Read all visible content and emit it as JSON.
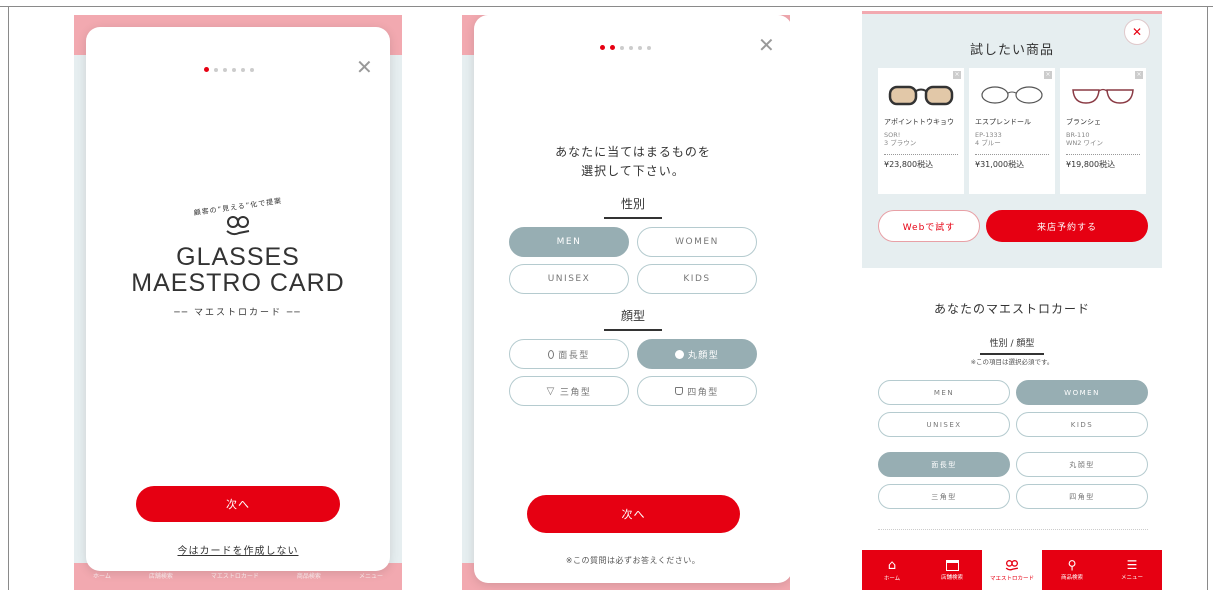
{
  "colors": {
    "accent": "#e60012",
    "selected": "#97aeb3",
    "pink": "#f2a9b0"
  },
  "panel1": {
    "logo_arc_text": "顧客の”見える”化で提案",
    "logo_icon": "glasses-hand-icon",
    "logo_line1": "GLASSES",
    "logo_line2": "MAESTRO CARD",
    "logo_sub": "── マエストロカード ──",
    "next_label": "次へ",
    "skip_label": "今はカードを作成しない",
    "bg_nav": [
      "ホーム",
      "店舗検索",
      "マエストロカード",
      "商品検索",
      "メニュー"
    ]
  },
  "panel2": {
    "question_line1": "あなたに当てはまるものを",
    "question_line2": "選択して下さい。",
    "gender_heading": "性別",
    "genders": [
      "MEN",
      "WOMEN",
      "UNISEX",
      "KIDS"
    ],
    "face_heading": "顔型",
    "faces": [
      "面長型",
      "丸顔型",
      "三角型",
      "四角型"
    ],
    "face_icons": [
      "oval-icon",
      "circle-icon",
      "triangle-icon",
      "square-icon"
    ],
    "next_label": "次へ",
    "note": "※この質問は必ずお答えください。"
  },
  "panel3": {
    "try_heading": "試したい商品",
    "products": [
      {
        "name": "アポイントトウキョウ",
        "model": "SOR!\n3 ブラウン",
        "price": "¥23,800税込"
      },
      {
        "name": "エスプレンドール",
        "model": "EP-1333\n4 ブルー",
        "price": "¥31,000税込"
      },
      {
        "name": "ブランシェ",
        "model": "BR-110\nWN2 ワイン",
        "price": "¥19,800税込"
      }
    ],
    "web_try_label": "Webで試す",
    "reserve_label": "来店予約する",
    "card_heading": "あなたのマエストロカード",
    "tab_label": "性別 / 顔型",
    "required_note": "※この項目は選択必須です。",
    "genders": [
      "MEN",
      "WOMEN",
      "UNISEX",
      "KIDS"
    ],
    "faces": [
      "面長型",
      "丸顔型",
      "三角型",
      "四角型"
    ],
    "nav": [
      "ホーム",
      "店舗検索",
      "マエストロカード",
      "商品検索",
      "メニュー"
    ]
  }
}
